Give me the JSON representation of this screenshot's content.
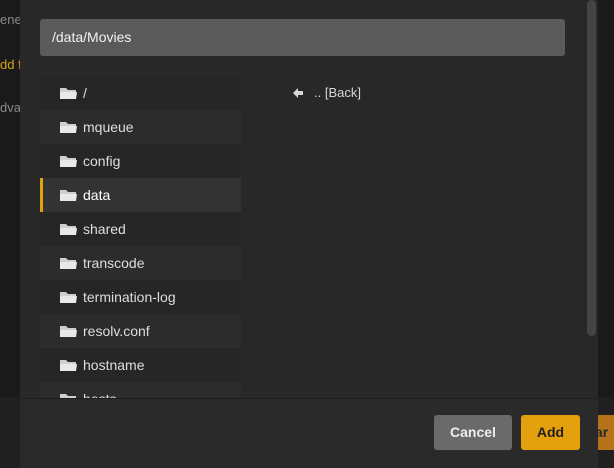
{
  "background": {
    "fragments": [
      "ene",
      "dd f",
      "dva"
    ],
    "right_button_label": "ar"
  },
  "dialog": {
    "path_value": "/data/Movies",
    "back_label": ".. [Back]",
    "directories": [
      {
        "label": "/",
        "selected": false
      },
      {
        "label": "mqueue",
        "selected": false
      },
      {
        "label": "config",
        "selected": false
      },
      {
        "label": "data",
        "selected": true
      },
      {
        "label": "shared",
        "selected": false
      },
      {
        "label": "transcode",
        "selected": false
      },
      {
        "label": "termination-log",
        "selected": false
      },
      {
        "label": "resolv.conf",
        "selected": false
      },
      {
        "label": "hostname",
        "selected": false
      },
      {
        "label": "hosts",
        "selected": false
      }
    ],
    "cancel_label": "Cancel",
    "add_label": "Add"
  },
  "colors": {
    "accent": "#e5a00d",
    "dialog_bg": "#282828",
    "path_bar_bg": "#5a5a5a",
    "cancel_bg": "#6a6a6a"
  },
  "icons": {
    "folder": "folder-icon",
    "back": "arrow-left-icon"
  }
}
